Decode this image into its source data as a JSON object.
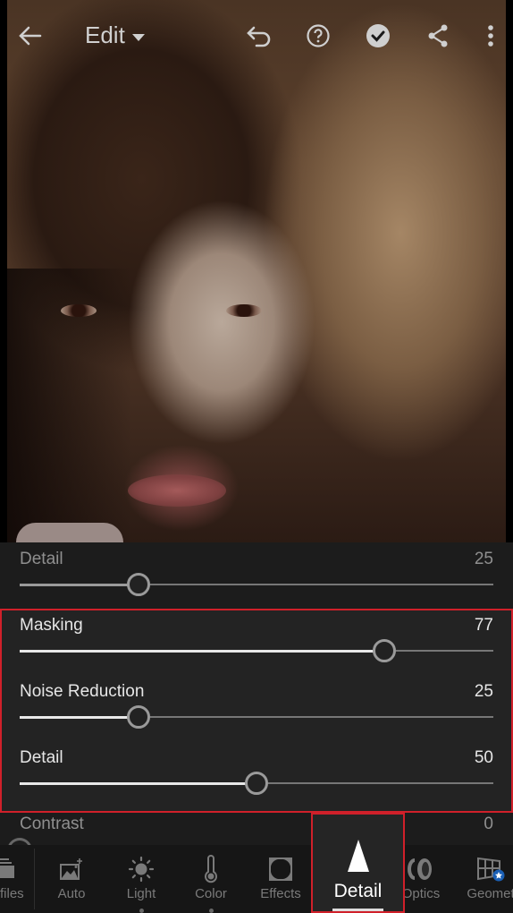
{
  "header": {
    "title": "Edit",
    "icons": [
      "back-arrow-icon",
      "dropdown-caret-icon",
      "undo-icon",
      "help-icon",
      "done-check-icon",
      "share-icon",
      "more-vertical-icon"
    ]
  },
  "photo": {
    "description": "portrait photo being edited"
  },
  "sharpening": {
    "detail": {
      "label": "Detail",
      "value": "25",
      "fraction": 0.25
    }
  },
  "noise_panel": {
    "masking": {
      "label": "Masking",
      "value": "77",
      "fraction": 0.77
    },
    "noise_reduction": {
      "label": "Noise Reduction",
      "value": "25",
      "fraction": 0.25
    },
    "detail": {
      "label": "Detail",
      "value": "50",
      "fraction": 0.5
    }
  },
  "contrast": {
    "label": "Contrast",
    "value": "0"
  },
  "toolbar": {
    "items": [
      {
        "label": "Profiles",
        "visible_label": "files"
      },
      {
        "label": "Auto"
      },
      {
        "label": "Light"
      },
      {
        "label": "Color"
      },
      {
        "label": "Effects"
      },
      {
        "label": "Detail",
        "active": true
      },
      {
        "label": "Optics",
        "visible_label": "Optics"
      },
      {
        "label": "Geometry",
        "visible_label": "Geomet"
      }
    ]
  },
  "colors": {
    "highlight": "#d0202a",
    "badge": "#1a5fb4"
  }
}
